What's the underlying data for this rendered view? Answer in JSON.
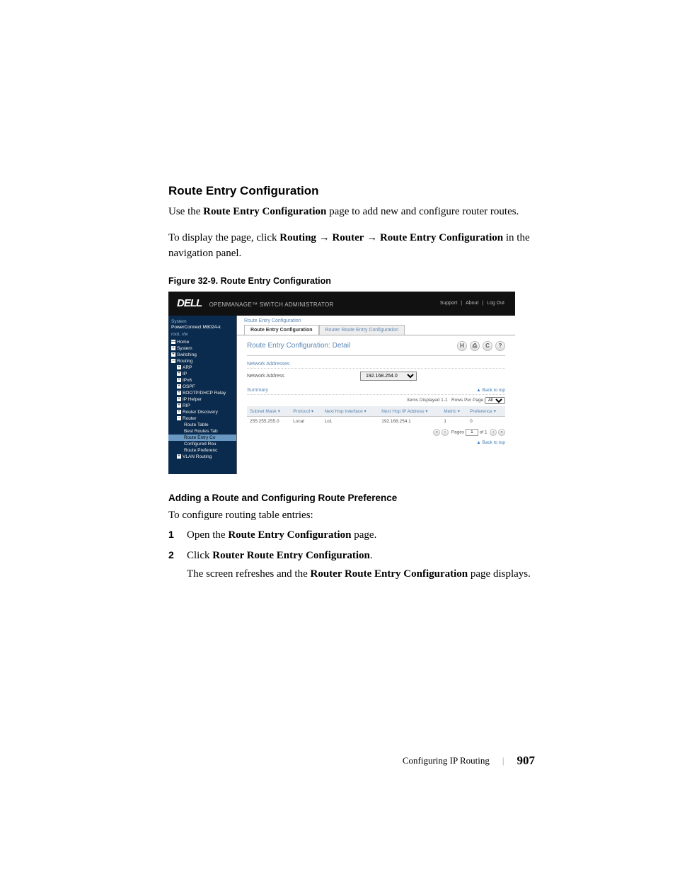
{
  "doc": {
    "section_heading": "Route Entry Configuration",
    "p1_a": "Use the ",
    "p1_b": "Route Entry Configuration",
    "p1_c": " page to add new and configure router routes.",
    "p2_a": "To display the page, click ",
    "p2_b": "Routing",
    "p2_arrow": " → ",
    "p2_c": "Router",
    "p2_d": "Route Entry Configuration",
    "p2_e": " in the navigation panel.",
    "figure_caption": "Figure 32-9.    Route Entry Configuration",
    "subsection_heading": "Adding a Route and Configuring Route Preference",
    "p3": "To configure routing table entries:",
    "step1_a": "Open the ",
    "step1_b": "Route Entry Configuration",
    "step1_c": " page.",
    "step2_a": "Click ",
    "step2_b": "Router Route Entry Configuration",
    "step2_c": ".",
    "step2p_a": "The screen refreshes and the ",
    "step2p_b": "Router Route Entry Configuration",
    "step2p_c": " page displays.",
    "footer_text": "Configuring IP Routing",
    "page_number": "907"
  },
  "ui": {
    "logo": "DELL",
    "logo_sub": "OPENMANAGE™ SWITCH ADMINISTRATOR",
    "header_links": {
      "support": "Support",
      "about": "About",
      "logout": "Log Out"
    },
    "sidebar": {
      "head": "System",
      "device": "PowerConnect M8024-k",
      "user": "root, r/w",
      "items": [
        {
          "label": "Home",
          "level": 0,
          "toggle": "—"
        },
        {
          "label": "System",
          "level": 0,
          "toggle": "+"
        },
        {
          "label": "Switching",
          "level": 0,
          "toggle": "+"
        },
        {
          "label": "Routing",
          "level": 0,
          "toggle": "−"
        },
        {
          "label": "ARP",
          "level": 1,
          "toggle": "+"
        },
        {
          "label": "IP",
          "level": 1,
          "toggle": "+"
        },
        {
          "label": "IPv6",
          "level": 1,
          "toggle": "+"
        },
        {
          "label": "OSPF",
          "level": 1,
          "toggle": "+"
        },
        {
          "label": "BOOTP/DHCP Relay",
          "level": 1,
          "toggle": "+"
        },
        {
          "label": "IP Helper",
          "level": 1,
          "toggle": "+"
        },
        {
          "label": "RIP",
          "level": 1,
          "toggle": "+"
        },
        {
          "label": "Router Discovery",
          "level": 1,
          "toggle": "+"
        },
        {
          "label": "Router",
          "level": 1,
          "toggle": "−"
        },
        {
          "label": "Route Table",
          "level": 2,
          "toggle": ""
        },
        {
          "label": "Best Routes Tab",
          "level": 2,
          "toggle": ""
        },
        {
          "label": "Route Entry Co",
          "level": 2,
          "toggle": "",
          "selected": true
        },
        {
          "label": "Configured Rou",
          "level": 2,
          "toggle": ""
        },
        {
          "label": "Route Preferenc",
          "level": 2,
          "toggle": ""
        },
        {
          "label": "VLAN Routing",
          "level": 1,
          "toggle": "+"
        }
      ]
    },
    "breadcrumb": "Route Entry Configuration",
    "tabs": [
      "Route Entry Configuration",
      "Router Route Entry Configuration"
    ],
    "title": "Route Entry Configuration: Detail",
    "icons": {
      "h": "H",
      "print": "⎙",
      "refresh": "C",
      "help": "?"
    },
    "section_network": "Network Addresses",
    "form_label": "Network Address",
    "form_value": "192.168.254.0",
    "section_summary": "Summary",
    "back_to_top": "▲ Back to top",
    "items_displayed": "Items Displayed 1-1",
    "rows_per_page": "Rows Per Page",
    "rows_per_page_val": "All",
    "table": {
      "headers": [
        "Subnet Mask",
        "Protocol",
        "Next Hop Interface",
        "Next Hop IP Address",
        "Metric",
        "Preference"
      ],
      "row": [
        "255.255.255.0",
        "Local",
        "Lo1",
        "192.168.254.1",
        "1",
        "0"
      ]
    },
    "pager_label": "Pages",
    "pager_value": "1",
    "pager_of": "of 1"
  }
}
